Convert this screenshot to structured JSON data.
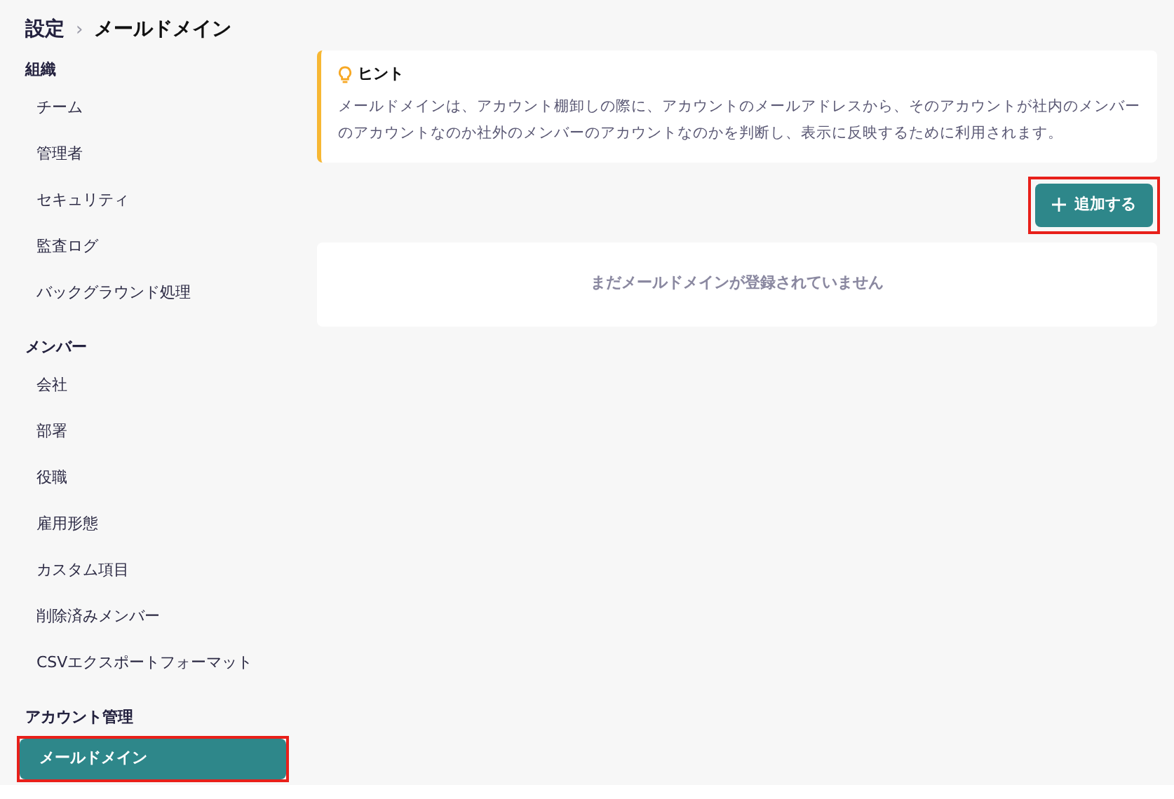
{
  "breadcrumb": [
    {
      "label": "設定",
      "current": false
    },
    {
      "label": "メールドメイン",
      "current": true
    }
  ],
  "breadcrumb_separator": "›",
  "sidebar": {
    "sections": [
      {
        "title": "組織",
        "items": [
          {
            "label": "チーム",
            "selected": false,
            "highlighted": false
          },
          {
            "label": "管理者",
            "selected": false,
            "highlighted": false
          },
          {
            "label": "セキュリティ",
            "selected": false,
            "highlighted": false
          },
          {
            "label": "監査ログ",
            "selected": false,
            "highlighted": false
          },
          {
            "label": "バックグラウンド処理",
            "selected": false,
            "highlighted": false
          }
        ]
      },
      {
        "title": "メンバー",
        "items": [
          {
            "label": "会社",
            "selected": false,
            "highlighted": false
          },
          {
            "label": "部署",
            "selected": false,
            "highlighted": false
          },
          {
            "label": "役職",
            "selected": false,
            "highlighted": false
          },
          {
            "label": "雇用形態",
            "selected": false,
            "highlighted": false
          },
          {
            "label": "カスタム項目",
            "selected": false,
            "highlighted": false
          },
          {
            "label": "削除済みメンバー",
            "selected": false,
            "highlighted": false
          },
          {
            "label": "CSVエクスポートフォーマット",
            "selected": false,
            "highlighted": false
          }
        ]
      },
      {
        "title": "アカウント管理",
        "items": [
          {
            "label": "メールドメイン",
            "selected": true,
            "highlighted": true
          }
        ]
      }
    ]
  },
  "hint": {
    "title": "ヒント",
    "text": "メールドメインは、アカウント棚卸しの際に、アカウントのメールアドレスから、そのアカウントが社内のメンバーのアカウントなのか社外のメンバーのアカウントなのかを判断し、表示に反映するために利用されます。"
  },
  "add_button": {
    "label": "追加する",
    "highlighted": true
  },
  "empty_state": "まだメールドメインが登録されていません"
}
